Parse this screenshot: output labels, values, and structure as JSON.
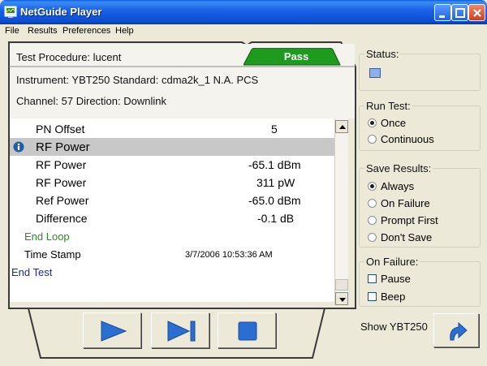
{
  "window": {
    "title": "NetGuide Player"
  },
  "menu": [
    {
      "label": "File"
    },
    {
      "label": "Results"
    },
    {
      "label": "Preferences"
    },
    {
      "label": "Help"
    }
  ],
  "test": {
    "procedure": "Test Procedure: lucent",
    "instrument": "Instrument: YBT250 Standard: cdma2k_1 N.A. PCS",
    "channel": "Channel: 57 Direction: Downlink",
    "result": "Pass"
  },
  "list": {
    "rows": [
      {
        "label": "PN Offset",
        "value": "5"
      },
      {
        "label": "RF Power",
        "value": ""
      },
      {
        "label": "RF Power",
        "value": "-65.1 dBm"
      },
      {
        "label": "RF Power",
        "value": "311 pW"
      },
      {
        "label": "Ref Power",
        "value": "-65.0 dBm"
      },
      {
        "label": "Difference",
        "value": "-0.1 dB"
      },
      {
        "label": "End Loop",
        "value": ""
      },
      {
        "label": "Time Stamp",
        "value": "3/7/2006 10:53:36 AM"
      },
      {
        "label": "End Test",
        "value": ""
      }
    ]
  },
  "status": {
    "title": "Status:"
  },
  "run_test": {
    "title": "Run Test:",
    "options": [
      {
        "label": "Once",
        "selected": true
      },
      {
        "label": "Continuous",
        "selected": false
      }
    ]
  },
  "save_results": {
    "title": "Save Results:",
    "options": [
      {
        "label": "Always",
        "selected": true
      },
      {
        "label": "On Failure",
        "selected": false
      },
      {
        "label": "Prompt First",
        "selected": false
      },
      {
        "label": "Don't Save",
        "selected": false
      }
    ]
  },
  "on_failure": {
    "title": "On Failure:",
    "options": [
      {
        "label": "Pause",
        "checked": false
      },
      {
        "label": "Beep",
        "checked": false
      }
    ]
  },
  "show_instrument": "Show YBT250",
  "colors": {
    "pass": "#1e9a1e",
    "selected_row": "#c8c8c8",
    "loop_text": "#2a8a2a",
    "end_test_text": "#1a2a9a",
    "play_blue": "#2a6fd0"
  },
  "icons": {
    "app": "app-icon",
    "info": "info-icon",
    "play": "play-icon",
    "step": "step-forward-icon",
    "stop": "stop-icon",
    "redo": "redo-arrow-icon"
  }
}
